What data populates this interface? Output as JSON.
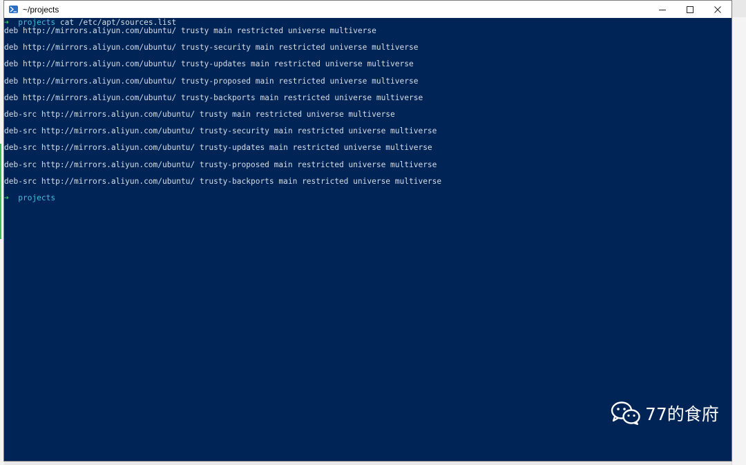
{
  "window": {
    "title": "~/projects"
  },
  "terminal": {
    "command_line": {
      "arrow": "➜",
      "dir": "projects",
      "command": "cat /etc/apt/sources.list"
    },
    "output": [
      "deb http://mirrors.aliyun.com/ubuntu/ trusty main restricted universe multiverse",
      "deb http://mirrors.aliyun.com/ubuntu/ trusty-security main restricted universe multiverse",
      "deb http://mirrors.aliyun.com/ubuntu/ trusty-updates main restricted universe multiverse",
      "deb http://mirrors.aliyun.com/ubuntu/ trusty-proposed main restricted universe multiverse",
      "deb http://mirrors.aliyun.com/ubuntu/ trusty-backports main restricted universe multiverse",
      "deb-src http://mirrors.aliyun.com/ubuntu/ trusty main restricted universe multiverse",
      "deb-src http://mirrors.aliyun.com/ubuntu/ trusty-security main restricted universe multiverse",
      "deb-src http://mirrors.aliyun.com/ubuntu/ trusty-updates main restricted universe multiverse",
      "deb-src http://mirrors.aliyun.com/ubuntu/ trusty-proposed main restricted universe multiverse",
      "deb-src http://mirrors.aliyun.com/ubuntu/ trusty-backports main restricted universe multiverse"
    ],
    "prompt": {
      "arrow": "➜",
      "dir": "projects"
    }
  },
  "watermark": {
    "text": "77的食府",
    "icon": "wechat-icon"
  },
  "colors": {
    "terminal_bg": "#012456",
    "terminal_fg": "#d7dde6",
    "prompt_arrow": "#2fd05b",
    "prompt_dir": "#3fc0d8"
  }
}
